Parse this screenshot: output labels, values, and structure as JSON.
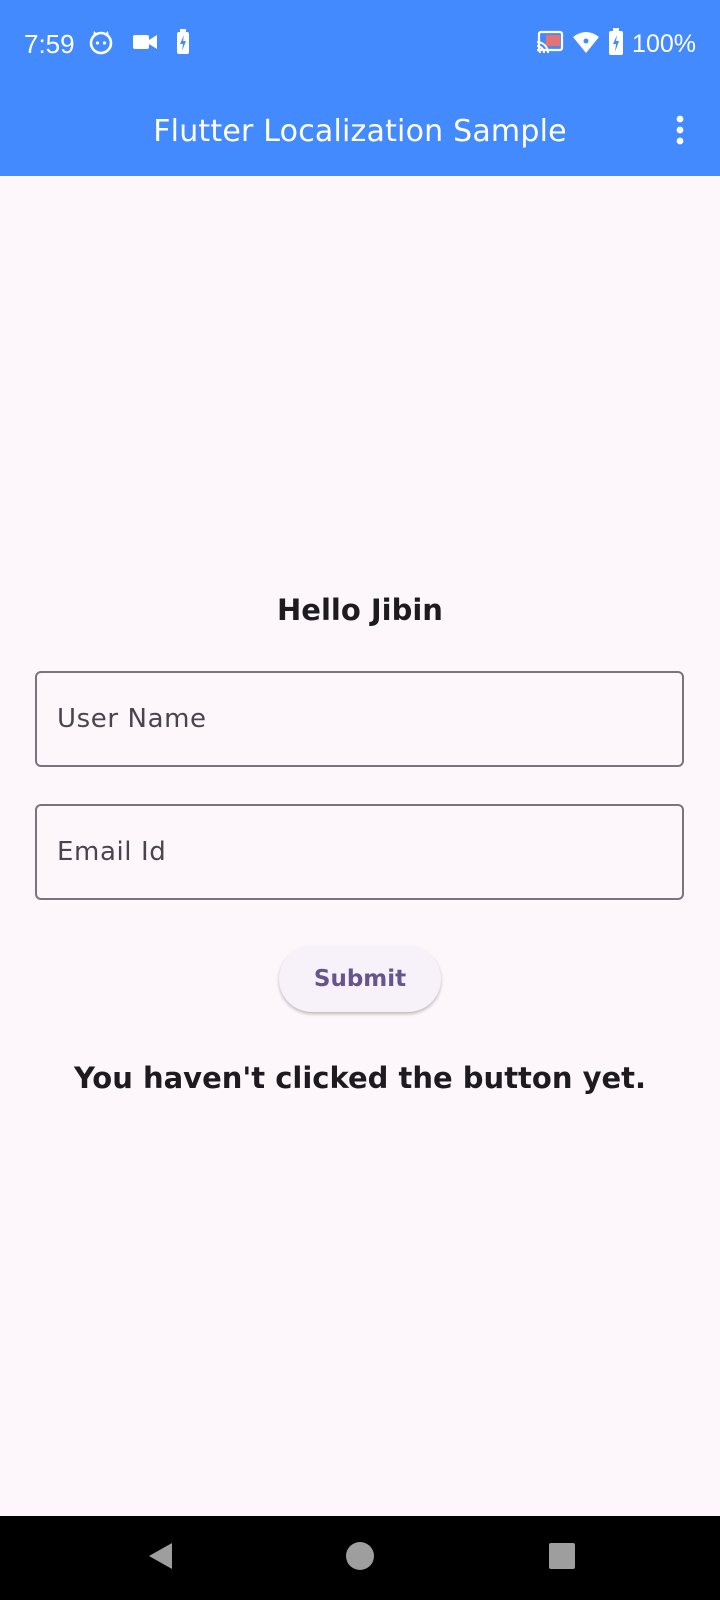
{
  "status_bar": {
    "time": "7:59",
    "left_icons": [
      "cat-face-icon",
      "video-camera-icon",
      "battery-saver-icon"
    ],
    "right_icons": [
      "cast-icon",
      "wifi-icon",
      "battery-icon"
    ],
    "battery_percent": "100%"
  },
  "app_bar": {
    "title": "Flutter Localization Sample",
    "menu_icon": "more-vert-icon"
  },
  "content": {
    "greeting": "Hello Jibin",
    "username_field": {
      "placeholder": "User Name",
      "value": ""
    },
    "email_field": {
      "placeholder": "Email Id",
      "value": ""
    },
    "submit_label": "Submit",
    "status_message": "You haven't clicked the button yet."
  },
  "nav_bar": {
    "icons": [
      "back-icon",
      "home-icon",
      "recents-icon"
    ]
  },
  "colors": {
    "app_bar": "#448aff",
    "background": "#fdf7fb",
    "button_text": "#65558f",
    "outline": "#79747e"
  }
}
